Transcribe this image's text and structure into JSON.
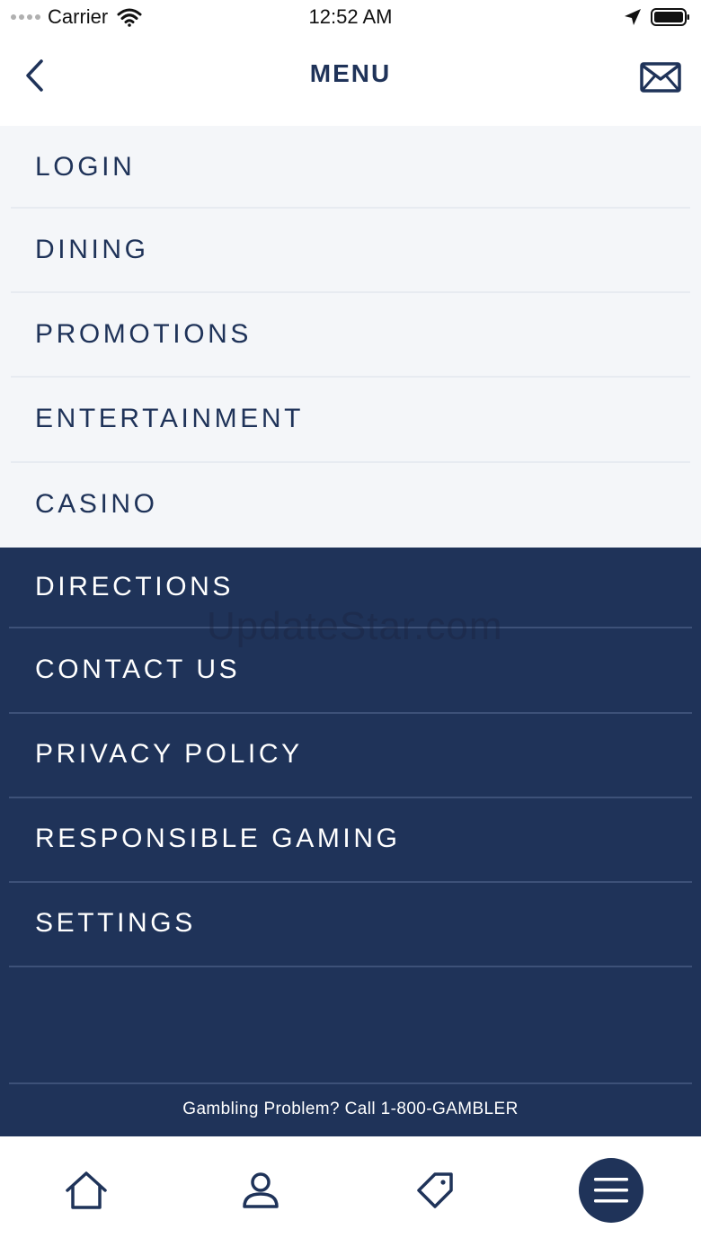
{
  "status_bar": {
    "carrier": "Carrier",
    "time": "12:52 AM"
  },
  "nav": {
    "title": "MENU",
    "back_icon": "chevron-left-icon",
    "mail_icon": "mail-icon"
  },
  "menu": {
    "primary": [
      "LOGIN",
      "DINING",
      "PROMOTIONS",
      "ENTERTAINMENT",
      "CASINO"
    ],
    "secondary": [
      "DIRECTIONS",
      "CONTACT US",
      "PRIVACY POLICY",
      "RESPONSIBLE GAMING",
      "SETTINGS"
    ]
  },
  "footer": {
    "note": "Gambling Problem? Call 1-800-GAMBLER"
  },
  "watermark": "UpdateStar.com",
  "tab_bar": {
    "tabs": [
      {
        "icon": "home-icon",
        "active": false
      },
      {
        "icon": "user-icon",
        "active": false
      },
      {
        "icon": "tag-icon",
        "active": false
      },
      {
        "icon": "hamburger-menu-icon",
        "active": true
      }
    ]
  },
  "colors": {
    "primary": "#1f3359",
    "light_background": "#f4f6f9",
    "white": "#ffffff"
  }
}
